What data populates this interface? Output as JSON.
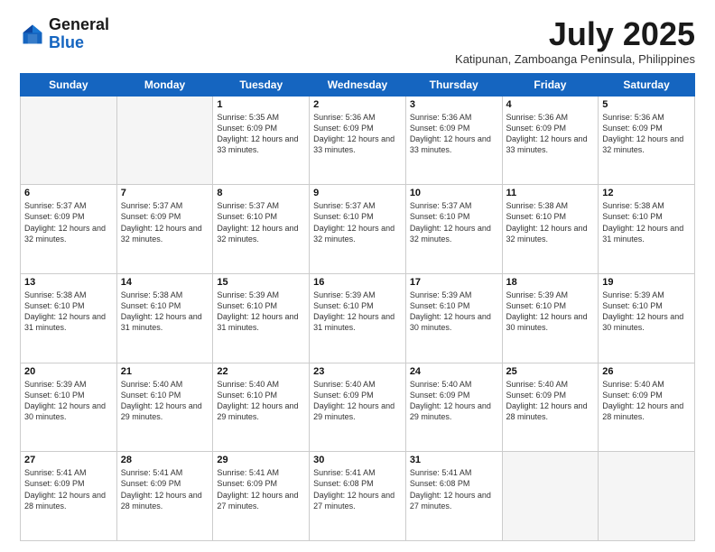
{
  "logo": {
    "general": "General",
    "blue": "Blue"
  },
  "title": "July 2025",
  "subtitle": "Katipunan, Zamboanga Peninsula, Philippines",
  "weekdays": [
    "Sunday",
    "Monday",
    "Tuesday",
    "Wednesday",
    "Thursday",
    "Friday",
    "Saturday"
  ],
  "weeks": [
    [
      {
        "day": "",
        "info": ""
      },
      {
        "day": "",
        "info": ""
      },
      {
        "day": "1",
        "info": "Sunrise: 5:35 AM\nSunset: 6:09 PM\nDaylight: 12 hours and 33 minutes."
      },
      {
        "day": "2",
        "info": "Sunrise: 5:36 AM\nSunset: 6:09 PM\nDaylight: 12 hours and 33 minutes."
      },
      {
        "day": "3",
        "info": "Sunrise: 5:36 AM\nSunset: 6:09 PM\nDaylight: 12 hours and 33 minutes."
      },
      {
        "day": "4",
        "info": "Sunrise: 5:36 AM\nSunset: 6:09 PM\nDaylight: 12 hours and 33 minutes."
      },
      {
        "day": "5",
        "info": "Sunrise: 5:36 AM\nSunset: 6:09 PM\nDaylight: 12 hours and 32 minutes."
      }
    ],
    [
      {
        "day": "6",
        "info": "Sunrise: 5:37 AM\nSunset: 6:09 PM\nDaylight: 12 hours and 32 minutes."
      },
      {
        "day": "7",
        "info": "Sunrise: 5:37 AM\nSunset: 6:09 PM\nDaylight: 12 hours and 32 minutes."
      },
      {
        "day": "8",
        "info": "Sunrise: 5:37 AM\nSunset: 6:10 PM\nDaylight: 12 hours and 32 minutes."
      },
      {
        "day": "9",
        "info": "Sunrise: 5:37 AM\nSunset: 6:10 PM\nDaylight: 12 hours and 32 minutes."
      },
      {
        "day": "10",
        "info": "Sunrise: 5:37 AM\nSunset: 6:10 PM\nDaylight: 12 hours and 32 minutes."
      },
      {
        "day": "11",
        "info": "Sunrise: 5:38 AM\nSunset: 6:10 PM\nDaylight: 12 hours and 32 minutes."
      },
      {
        "day": "12",
        "info": "Sunrise: 5:38 AM\nSunset: 6:10 PM\nDaylight: 12 hours and 31 minutes."
      }
    ],
    [
      {
        "day": "13",
        "info": "Sunrise: 5:38 AM\nSunset: 6:10 PM\nDaylight: 12 hours and 31 minutes."
      },
      {
        "day": "14",
        "info": "Sunrise: 5:38 AM\nSunset: 6:10 PM\nDaylight: 12 hours and 31 minutes."
      },
      {
        "day": "15",
        "info": "Sunrise: 5:39 AM\nSunset: 6:10 PM\nDaylight: 12 hours and 31 minutes."
      },
      {
        "day": "16",
        "info": "Sunrise: 5:39 AM\nSunset: 6:10 PM\nDaylight: 12 hours and 31 minutes."
      },
      {
        "day": "17",
        "info": "Sunrise: 5:39 AM\nSunset: 6:10 PM\nDaylight: 12 hours and 30 minutes."
      },
      {
        "day": "18",
        "info": "Sunrise: 5:39 AM\nSunset: 6:10 PM\nDaylight: 12 hours and 30 minutes."
      },
      {
        "day": "19",
        "info": "Sunrise: 5:39 AM\nSunset: 6:10 PM\nDaylight: 12 hours and 30 minutes."
      }
    ],
    [
      {
        "day": "20",
        "info": "Sunrise: 5:39 AM\nSunset: 6:10 PM\nDaylight: 12 hours and 30 minutes."
      },
      {
        "day": "21",
        "info": "Sunrise: 5:40 AM\nSunset: 6:10 PM\nDaylight: 12 hours and 29 minutes."
      },
      {
        "day": "22",
        "info": "Sunrise: 5:40 AM\nSunset: 6:10 PM\nDaylight: 12 hours and 29 minutes."
      },
      {
        "day": "23",
        "info": "Sunrise: 5:40 AM\nSunset: 6:09 PM\nDaylight: 12 hours and 29 minutes."
      },
      {
        "day": "24",
        "info": "Sunrise: 5:40 AM\nSunset: 6:09 PM\nDaylight: 12 hours and 29 minutes."
      },
      {
        "day": "25",
        "info": "Sunrise: 5:40 AM\nSunset: 6:09 PM\nDaylight: 12 hours and 28 minutes."
      },
      {
        "day": "26",
        "info": "Sunrise: 5:40 AM\nSunset: 6:09 PM\nDaylight: 12 hours and 28 minutes."
      }
    ],
    [
      {
        "day": "27",
        "info": "Sunrise: 5:41 AM\nSunset: 6:09 PM\nDaylight: 12 hours and 28 minutes."
      },
      {
        "day": "28",
        "info": "Sunrise: 5:41 AM\nSunset: 6:09 PM\nDaylight: 12 hours and 28 minutes."
      },
      {
        "day": "29",
        "info": "Sunrise: 5:41 AM\nSunset: 6:09 PM\nDaylight: 12 hours and 27 minutes."
      },
      {
        "day": "30",
        "info": "Sunrise: 5:41 AM\nSunset: 6:08 PM\nDaylight: 12 hours and 27 minutes."
      },
      {
        "day": "31",
        "info": "Sunrise: 5:41 AM\nSunset: 6:08 PM\nDaylight: 12 hours and 27 minutes."
      },
      {
        "day": "",
        "info": ""
      },
      {
        "day": "",
        "info": ""
      }
    ]
  ]
}
